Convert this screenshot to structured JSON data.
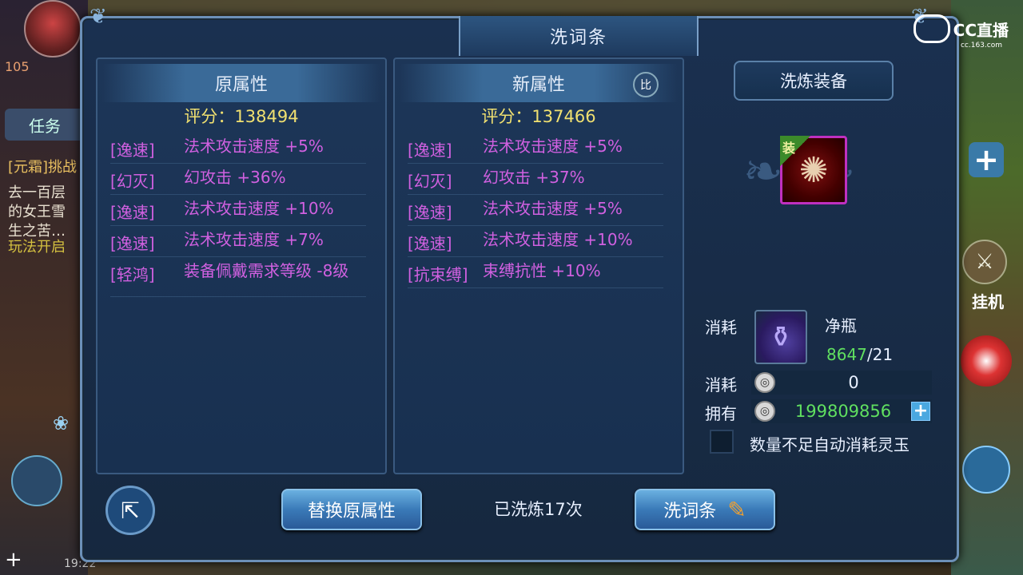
{
  "background": {
    "level": "105",
    "task_tab": "任务",
    "chat_lines": [
      "[元霜]挑战",
      "去一百层",
      "的女王雪",
      "生之苦…",
      "玩法开启"
    ],
    "hangji": "挂机",
    "time": "19:22",
    "watermark": "CC直播",
    "watermark_sub": "cc.163.com"
  },
  "panel": {
    "title": "洗词条"
  },
  "original": {
    "header": "原属性",
    "score": "评分：138494",
    "attrs": [
      {
        "tag": "[逸速]",
        "value": "法术攻击速度 +5%"
      },
      {
        "tag": "[幻灭]",
        "value": "幻攻击 +36%"
      },
      {
        "tag": "[逸速]",
        "value": "法术攻击速度 +10%"
      },
      {
        "tag": "[逸速]",
        "value": "法术攻击速度 +7%"
      },
      {
        "tag": "[轻鸿]",
        "value": "装备佩戴需求等级 -8级"
      }
    ]
  },
  "new_attrs": {
    "header": "新属性",
    "compare_label": "比",
    "score": "评分：137466",
    "attrs": [
      {
        "tag": "[逸速]",
        "value": "法术攻击速度 +5%"
      },
      {
        "tag": "[幻灭]",
        "value": "幻攻击 +37%"
      },
      {
        "tag": "[逸速]",
        "value": "法术攻击速度 +5%"
      },
      {
        "tag": "[逸速]",
        "value": "法术攻击速度 +10%"
      },
      {
        "tag": "[抗束缚]",
        "value": "束缚抗性 +10%"
      }
    ]
  },
  "equip": {
    "header": "洗炼装备",
    "badge": "装"
  },
  "cost": {
    "label1": "消耗",
    "item_name": "净瓶",
    "item_have": "8647",
    "item_need": "/21",
    "label2": "消耗",
    "coin_cost": "0",
    "label3": "拥有",
    "coin_have": "199809856",
    "auto_label": "数量不足自动消耗灵玉"
  },
  "actions": {
    "replace": "替换原属性",
    "count": "已洗炼17次",
    "reroll": "洗词条"
  },
  "colors": {
    "attr_purple": "#d060e0",
    "score_yellow": "#f0e070",
    "green": "#60e060"
  }
}
